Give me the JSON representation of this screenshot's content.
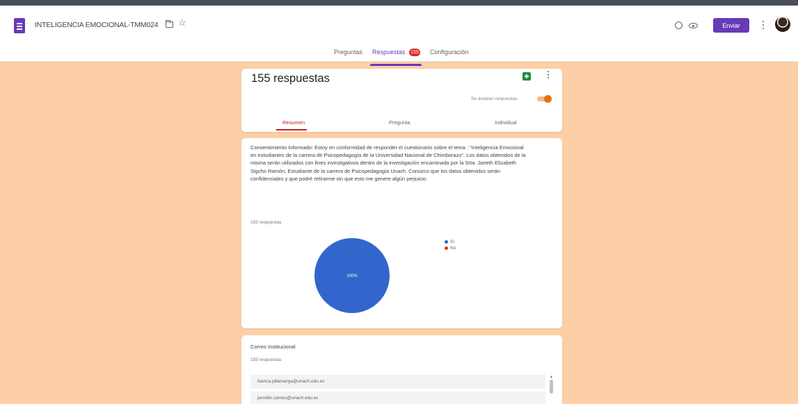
{
  "app": {
    "doc_title": "INTELIGENCIA EMOCIONAL-TMM024",
    "send_label": "Enviar",
    "icons": [
      "forms-logo-icon",
      "folder-icon",
      "star-icon",
      "palette-icon",
      "preview-icon",
      "more-vert-icon",
      "avatar"
    ]
  },
  "tabs": [
    {
      "label": "Preguntas"
    },
    {
      "label": "Respuestas",
      "badge": "155",
      "active": true
    },
    {
      "label": "Configuración"
    }
  ],
  "summary": {
    "count_label": "155 respuestas",
    "accepting_label": "Se aceptan respuestas",
    "accepting": true,
    "sub_tabs": [
      {
        "label": "Resumen",
        "active": true
      },
      {
        "label": "Pregunta"
      },
      {
        "label": "Individual"
      }
    ]
  },
  "consent": {
    "question": "Consentimiento Informado: Estoy en conformidad de responder el cuestionario sobre el tema : “Inteligencia Emocional en estudiantes de la carrera de Psicopedagogía de la Universidad Nacional de Chimborazo”. Los datos obtenidos de la misma serán utilizados con fines investigativos dentro de la investigación encaminada por la Srta. Janeth Elizabeth Sigcho Ramón, Estudiante de la carrera de Psicopedagogía Unach. Conozco que los datos obtenidos serán confidenciales y que podré retirarme sin que esto me genere algún perjuicio.",
    "responses_label": "155 respuestas"
  },
  "email": {
    "title": "Correo Institucional",
    "responses_label": "155 respuestas",
    "rows": [
      "bianca.pillamarga@unach.edu.ec",
      "jennifer.camas@unach.edu.ec"
    ]
  },
  "chart_data": {
    "type": "pie",
    "categories": [
      "Sí",
      "No"
    ],
    "values": [
      100,
      0
    ],
    "slice_label": "100%",
    "colors": [
      "#3366cc",
      "#dc3912"
    ],
    "legend_position": "top-right"
  }
}
